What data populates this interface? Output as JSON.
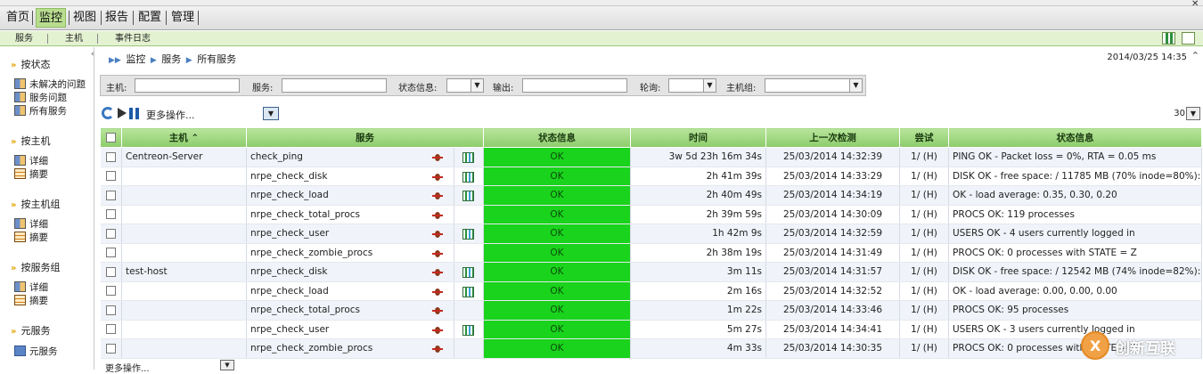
{
  "menu": {
    "tabs": [
      "首页",
      "监控",
      "视图",
      "报告",
      "配置",
      "管理"
    ],
    "active": "监控"
  },
  "submenu": {
    "items": [
      "服务",
      "主机",
      "事件日志"
    ]
  },
  "sidebar": {
    "groups": [
      {
        "title": "按状态",
        "links": [
          "未解决的问题",
          "服务问题",
          "所有服务"
        ]
      },
      {
        "title": "按主机",
        "links": [
          "详细",
          "摘要"
        ]
      },
      {
        "title": "按主机组",
        "links": [
          "详细",
          "摘要"
        ]
      },
      {
        "title": "按服务组",
        "links": [
          "详细",
          "摘要"
        ]
      },
      {
        "title": "元服务",
        "links": [
          "元服务"
        ]
      }
    ]
  },
  "breadcrumb": [
    "监控",
    "服务",
    "所有服务"
  ],
  "timestamp": "2014/03/25 14:35",
  "filters": {
    "host_label": "主机:",
    "service_label": "服务:",
    "status_label": "状态信息:",
    "output_label": "输出:",
    "poller_label": "轮询:",
    "hostgroup_label": "主机组:"
  },
  "actions": {
    "more_actions": "更多操作...",
    "page_size": "30",
    "bottom_more_actions": "更多操作..."
  },
  "table": {
    "columns": [
      "主机",
      "服务",
      "状态信息",
      "时间",
      "上一次检测",
      "尝试",
      "状态信息"
    ],
    "rows": [
      {
        "host": "Centreon-Server",
        "service": "check_ping",
        "graph": true,
        "status": "OK",
        "duration": "3w 5d 23h 16m 34s",
        "last_check": "25/03/2014 14:32:39",
        "tries": "1/ (H)",
        "info": "PING OK - Packet loss = 0%, RTA = 0.05 ms"
      },
      {
        "host": "",
        "service": "nrpe_check_disk",
        "graph": true,
        "status": "OK",
        "duration": "2h 41m 39s",
        "last_check": "25/03/2014 14:33:29",
        "tries": "1/ (H)",
        "info": "DISK OK - free space: / 11785 MB (70% inode=80%):"
      },
      {
        "host": "",
        "service": "nrpe_check_load",
        "graph": true,
        "status": "OK",
        "duration": "2h 40m 49s",
        "last_check": "25/03/2014 14:34:19",
        "tries": "1/ (H)",
        "info": "OK - load average: 0.35, 0.30, 0.20"
      },
      {
        "host": "",
        "service": "nrpe_check_total_procs",
        "graph": false,
        "status": "OK",
        "duration": "2h 39m 59s",
        "last_check": "25/03/2014 14:30:09",
        "tries": "1/ (H)",
        "info": "PROCS OK: 119 processes"
      },
      {
        "host": "",
        "service": "nrpe_check_user",
        "graph": true,
        "status": "OK",
        "duration": "1h 42m 9s",
        "last_check": "25/03/2014 14:32:59",
        "tries": "1/ (H)",
        "info": "USERS OK - 4 users currently logged in"
      },
      {
        "host": "",
        "service": "nrpe_check_zombie_procs",
        "graph": false,
        "status": "OK",
        "duration": "2h 38m 19s",
        "last_check": "25/03/2014 14:31:49",
        "tries": "1/ (H)",
        "info": "PROCS OK: 0 processes with STATE = Z"
      },
      {
        "host": "test-host",
        "service": "nrpe_check_disk",
        "graph": true,
        "status": "OK",
        "duration": "3m 11s",
        "last_check": "25/03/2014 14:31:57",
        "tries": "1/ (H)",
        "info": "DISK OK - free space: / 12542 MB (74% inode=82%):"
      },
      {
        "host": "",
        "service": "nrpe_check_load",
        "graph": true,
        "status": "OK",
        "duration": "2m 16s",
        "last_check": "25/03/2014 14:32:52",
        "tries": "1/ (H)",
        "info": "OK - load average: 0.00, 0.00, 0.00"
      },
      {
        "host": "",
        "service": "nrpe_check_total_procs",
        "graph": false,
        "status": "OK",
        "duration": "1m 22s",
        "last_check": "25/03/2014 14:33:46",
        "tries": "1/ (H)",
        "info": "PROCS OK: 95 processes"
      },
      {
        "host": "",
        "service": "nrpe_check_user",
        "graph": true,
        "status": "OK",
        "duration": "5m 27s",
        "last_check": "25/03/2014 14:34:41",
        "tries": "1/ (H)",
        "info": "USERS OK - 3 users currently logged in"
      },
      {
        "host": "",
        "service": "nrpe_check_zombie_procs",
        "graph": false,
        "status": "OK",
        "duration": "4m 33s",
        "last_check": "25/03/2014 14:30:35",
        "tries": "1/ (H)",
        "info": "PROCS OK: 0 processes with STATE = Z"
      }
    ]
  },
  "watermark": {
    "text": "创新互联"
  },
  "colors": {
    "ok": "#19d31c",
    "header_green": "#8dcc6b",
    "row_alt": "#f0f4fa"
  }
}
